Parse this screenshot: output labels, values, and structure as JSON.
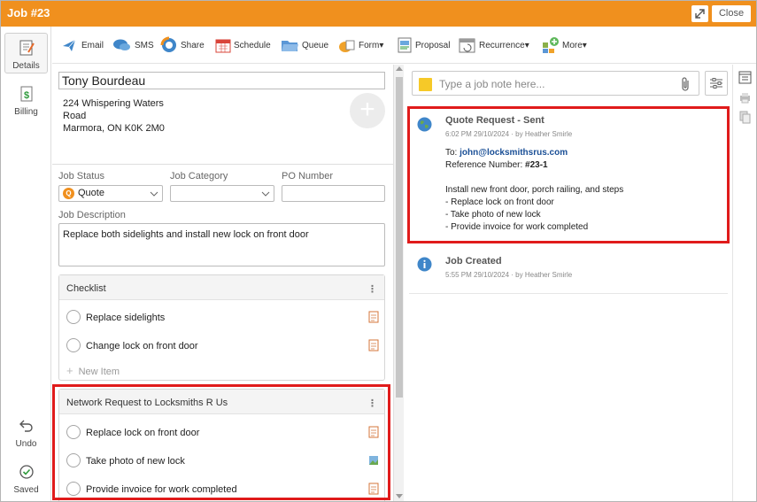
{
  "window": {
    "title": "Job #23",
    "close_label": "Close"
  },
  "sidenav": {
    "details": "Details",
    "billing": "Billing",
    "undo": "Undo",
    "saved": "Saved"
  },
  "toolbar": {
    "email": "Email",
    "sms": "SMS",
    "share": "Share",
    "schedule": "Schedule",
    "queue": "Queue",
    "form": "Form▾",
    "proposal": "Proposal",
    "recurrence": "Recurrence▾",
    "more": "More▾"
  },
  "job": {
    "client_name": "Tony Bourdeau",
    "address": [
      "224 Whispering Waters",
      "Road",
      "Marmora, ON K0K 2M0"
    ],
    "status_label": "Job Status",
    "status_value": "Quote",
    "status_badge": "Q",
    "category_label": "Job Category",
    "category_value": "",
    "po_label": "PO Number",
    "po_value": "",
    "description_label": "Job Description",
    "description": "Replace both sidelights and install new lock on front door"
  },
  "checklist": {
    "title": "Checklist",
    "items": [
      "Replace sidelights",
      "Change lock on front door"
    ],
    "new_item": "New Item"
  },
  "network_request": {
    "title": "Network Request to Locksmiths R Us",
    "items": [
      "Replace lock on front door",
      "Take photo of new lock",
      "Provide invoice for work completed"
    ]
  },
  "notes": {
    "placeholder": "Type a job note here..."
  },
  "activity": [
    {
      "title": "Quote Request - Sent",
      "meta": "6:02 PM 29/10/2024  ·  by Heather Smirle",
      "to_label": "To: ",
      "to_email": "john@locksmithsrus.com",
      "ref_label": "Reference Number: ",
      "ref_value": "#23-1",
      "body": [
        "Install new front door, porch railing, and steps",
        "- Replace lock on front door",
        "- Take photo of new lock",
        "- Provide invoice for work completed"
      ]
    },
    {
      "title": "Job Created",
      "meta": "5:55 PM 29/10/2024  ·  by Heather Smirle"
    }
  ],
  "colors": {
    "brand": "#f0901e",
    "highlight": "#e01b1b",
    "link": "#1a4f96"
  }
}
